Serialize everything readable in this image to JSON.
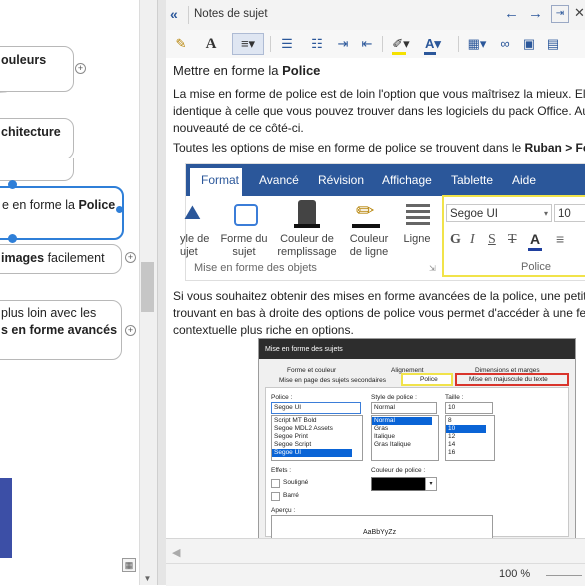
{
  "colors": {
    "accent": "#2b579a",
    "selected_node": "#2f7fd8",
    "highlight_yellow": "#f1e34a",
    "highlight_red": "#d9342b",
    "left_panel_blue": "#3c4fa6"
  },
  "mindmap": {
    "nodes": [
      {
        "line1": "ouleurs",
        "line2": ""
      },
      {
        "line1": "chitecture",
        "line2": ""
      },
      {
        "pre": "e en forme la ",
        "bold": "Police"
      },
      {
        "bold": "images",
        "post": " facilement"
      },
      {
        "line1": "plus loin avec les",
        "line2_bold": "s en forme avancés"
      }
    ]
  },
  "notes": {
    "title": "Notes de sujet",
    "heading": "Mettre en forme la ",
    "heading_bold": "Police",
    "para1_lines": [
      "La mise en forme de police est de loin l'option que vous maîtrisez la mieux. El",
      "identique à celle que vous pouvez trouver dans les logiciels du pack Office. Au",
      "nouveauté de ce côté-ci."
    ],
    "para2_pre": "Toutes les options de mise en forme de police se trouvent dans le ",
    "para2_bold": "Ruban > Fo",
    "para3_lines": [
      "Si vous souhaitez obtenir des mises en forme avancées de la police, une petit",
      "trouvant en bas à droite des options de police vous permet d'accéder à une fe",
      "contextuelle plus riche en options."
    ]
  },
  "ribbon": {
    "tabs": [
      "Format",
      "Avancé",
      "Révision",
      "Affichage",
      "Tablette",
      "Aide"
    ],
    "groups": [
      {
        "label1": "yle de",
        "label2": "ujet"
      },
      {
        "label1": "Forme du",
        "label2": "sujet"
      },
      {
        "label1": "Couleur de",
        "label2": "remplissage"
      },
      {
        "label1": "Couleur",
        "label2": "de ligne"
      },
      {
        "label1": "Ligne",
        "label2": ""
      }
    ],
    "group_caption": "Mise en forme des objets",
    "font_name": "Segoe UI",
    "font_size": "10",
    "font_group_caption": "Police"
  },
  "dialog": {
    "title": "Mise en forme des sujets",
    "tabs_row1": [
      "Forme et couleur",
      "Alignement",
      "Dimensions et marges"
    ],
    "tabs_row2": [
      "Mise en page des sujets secondaires",
      "Police",
      "Mise en majuscule du texte"
    ],
    "police_label": "Police :",
    "police_value": "Segoe UI",
    "police_list": [
      "Script MT Bold",
      "Segoe MDL2 Assets",
      "Segoe Print",
      "Segoe Script",
      "Segoe UI"
    ],
    "style_label": "Style de police :",
    "style_value": "Normal",
    "style_list": [
      "Normal",
      "Gras",
      "Italique",
      "Gras Italique"
    ],
    "size_label": "Taille :",
    "size_value": "10",
    "size_list": [
      "8",
      "10",
      "12",
      "14",
      "16"
    ],
    "effects_label": "Effets :",
    "underline_label": "Souligné",
    "strike_label": "Barré",
    "color_label": "Couleur de police :",
    "preview_label": "Aperçu :",
    "preview_text": "AaBbYyZz"
  },
  "footer": {
    "zoom": "100 %"
  }
}
